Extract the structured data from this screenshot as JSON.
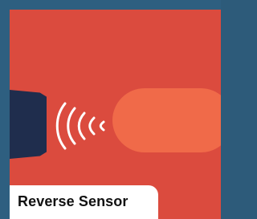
{
  "title": "Reverse Sensor",
  "icons": {
    "sensor": "parking-sensor-icon",
    "signal": "ultrasonic-wave-icon",
    "obstacle": "obstacle-shape-icon"
  },
  "colors": {
    "outer_background": "#2e5f80",
    "card_background": "#db4b3e",
    "sensor_body": "#1f2d4d",
    "obstacle": "#f06a49",
    "label_background": "#ffffff",
    "label_text": "#111111",
    "waves": "#ffffff"
  }
}
